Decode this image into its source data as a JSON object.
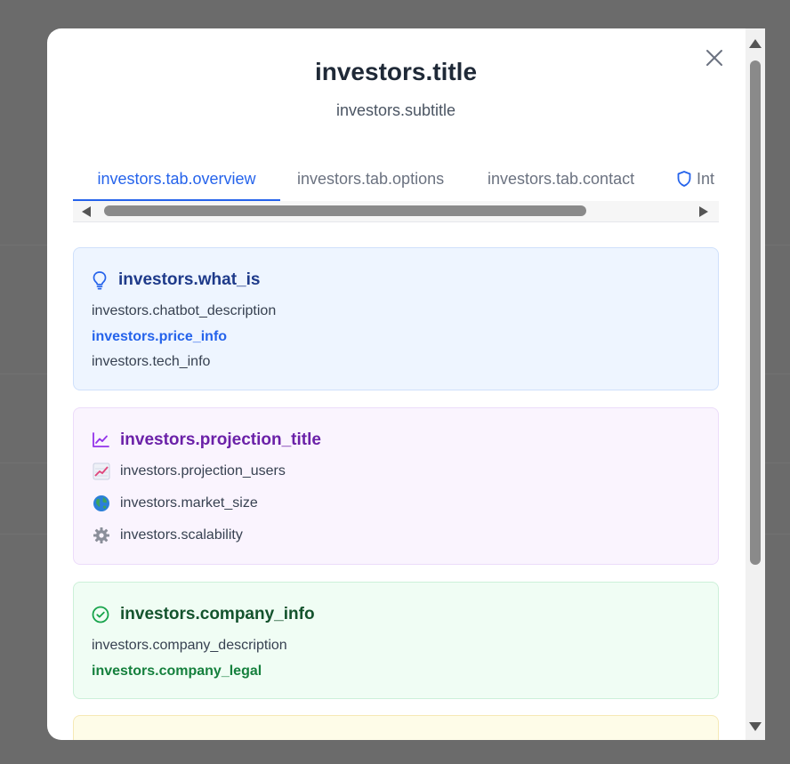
{
  "modal": {
    "title": "investors.title",
    "subtitle": "investors.subtitle"
  },
  "tabs": [
    {
      "label": "investors.tab.overview",
      "active": true
    },
    {
      "label": "investors.tab.options",
      "active": false
    },
    {
      "label": "investors.tab.contact",
      "active": false
    },
    {
      "label": "Int",
      "active": false
    }
  ],
  "cards": {
    "what_is": {
      "title": "investors.what_is",
      "lines": [
        "investors.chatbot_description",
        "investors.price_info",
        "investors.tech_info"
      ]
    },
    "projection": {
      "title": "investors.projection_title",
      "items": [
        {
          "icon": "chart-increasing-icon",
          "text": "investors.projection_users"
        },
        {
          "icon": "globe-icon",
          "text": "investors.market_size"
        },
        {
          "icon": "gear-icon",
          "text": "investors.scalability"
        }
      ]
    },
    "company": {
      "title": "investors.company_info",
      "lines": [
        "investors.company_description",
        "investors.company_legal"
      ]
    }
  },
  "colors": {
    "accent_blue": "#2563eb",
    "purple": "#6b21a8",
    "green": "#15803d",
    "title_blue": "#1e3a8a"
  }
}
